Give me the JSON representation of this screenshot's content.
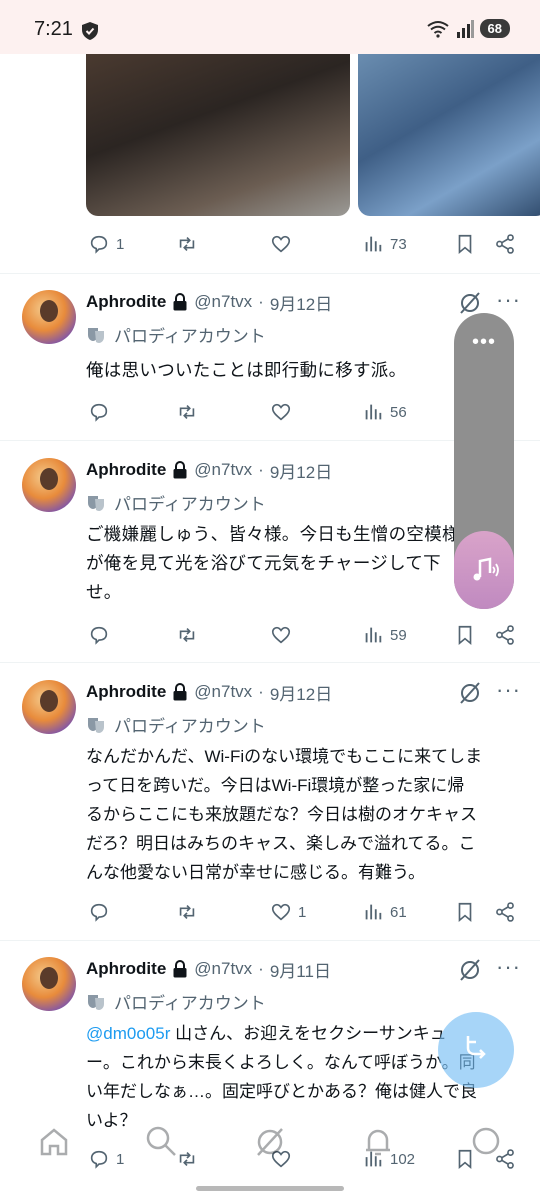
{
  "status": {
    "time": "7:21",
    "battery": "68"
  },
  "top_post": {
    "replies": "1",
    "views": "73"
  },
  "tweets": [
    {
      "name": "Aphrodite",
      "handle": "@n7tvx",
      "date": "9月12日",
      "label": "パロディアカウント",
      "lines": [
        "俺は思いついたことは即行動に移す派。"
      ],
      "replies": "",
      "likes": "",
      "views": "56"
    },
    {
      "name": "Aphrodite",
      "handle": "@n7tvx",
      "date": "9月12日",
      "label": "パロディアカウント",
      "lines": [
        "ご機嫌麗しゅう、皆々様。今日も生憎の空模様",
        "が俺を見て光を浴びて元気をチャージして下",
        "せ。"
      ],
      "replies": "",
      "likes": "",
      "views": "59"
    },
    {
      "name": "Aphrodite",
      "handle": "@n7tvx",
      "date": "9月12日",
      "label": "パロディアカウント",
      "lines": [
        "なんだかんだ、Wi-Fiのない環境でもここに来てしま",
        "って日を跨いだ。今日はWi-Fi環境が整った家に帰",
        "るからここにも来放題だな？今日は樹のオケキャス",
        "だろ？明日はみちのキャス、楽しみで溢れてる。こ",
        "んな他愛ない日常が幸せに感じる。有難う。"
      ],
      "replies": "",
      "likes": "1",
      "views": "61"
    },
    {
      "name": "Aphrodite",
      "handle": "@n7tvx",
      "date": "9月11日",
      "label": "パロディアカウント",
      "mention": "@dm0o05r",
      "lines": [
        " 山さん、お迎えをセクシーサンキュ",
        "ー。これから末長くよろしく。なんて呼ぼうか。同",
        "い年だしなぁ…。固定呼びとかある？俺は健人で良",
        "いよ？"
      ],
      "replies": "1",
      "likes": "",
      "views": "102"
    }
  ]
}
